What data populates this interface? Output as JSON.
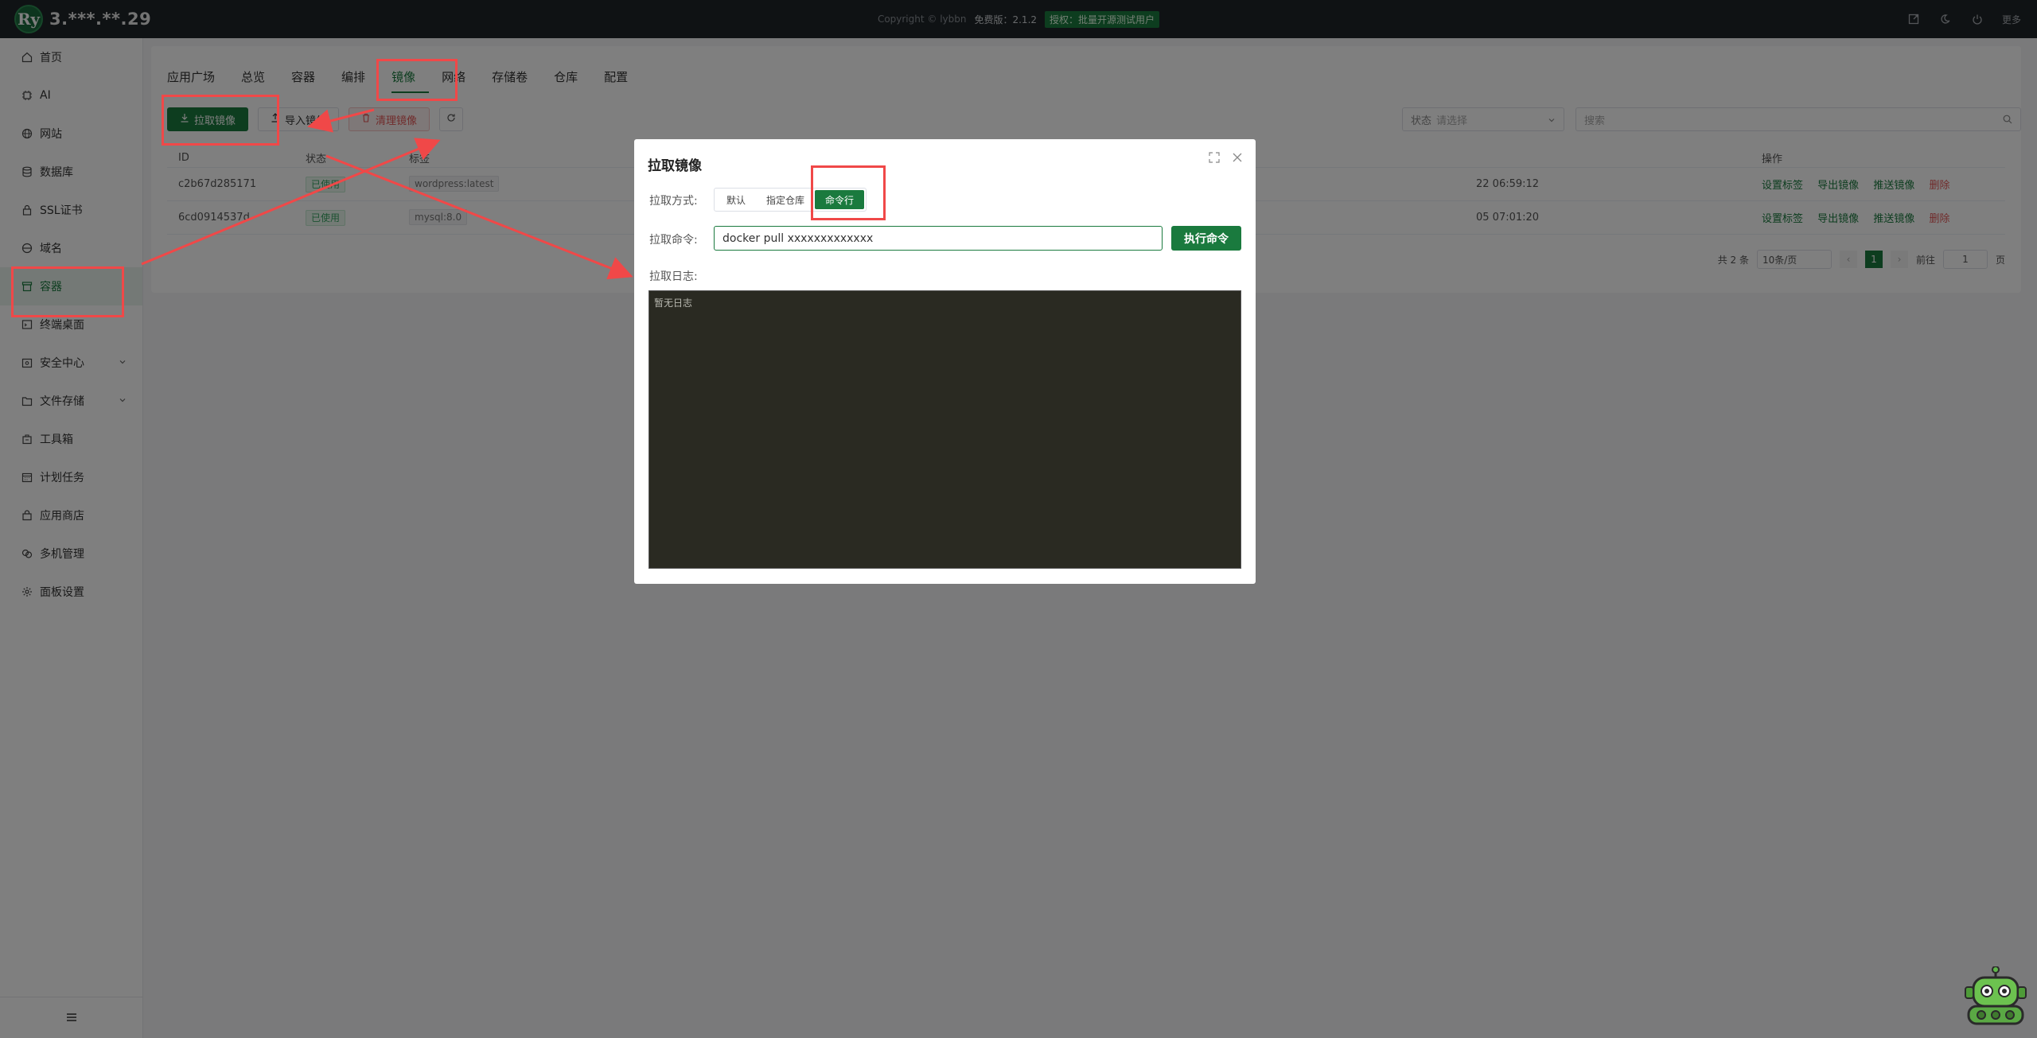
{
  "topbar": {
    "logo_text": "Ry",
    "host": "3.***.**.29",
    "copyright": "Copyright © lybbn",
    "edition": "免费版：2.1.2",
    "license": "授权：批量开源测试用户",
    "more": "更多"
  },
  "sidebar": {
    "items": [
      {
        "label": "首页",
        "icon": "home-icon"
      },
      {
        "label": "AI",
        "icon": "chip-icon"
      },
      {
        "label": "网站",
        "icon": "globe-icon"
      },
      {
        "label": "数据库",
        "icon": "database-icon"
      },
      {
        "label": "SSL证书",
        "icon": "lock-icon"
      },
      {
        "label": "域名",
        "icon": "domain-icon"
      },
      {
        "label": "容器",
        "icon": "container-icon"
      },
      {
        "label": "终端桌面",
        "icon": "terminal-icon"
      },
      {
        "label": "安全中心",
        "icon": "shield-icon"
      },
      {
        "label": "文件存储",
        "icon": "folder-icon"
      },
      {
        "label": "工具箱",
        "icon": "toolbox-icon"
      },
      {
        "label": "计划任务",
        "icon": "calendar-icon"
      },
      {
        "label": "应用商店",
        "icon": "store-icon"
      },
      {
        "label": "多机管理",
        "icon": "cluster-icon"
      },
      {
        "label": "面板设置",
        "icon": "gear-icon"
      }
    ]
  },
  "tabs": [
    "应用广场",
    "总览",
    "容器",
    "编排",
    "镜像",
    "网络",
    "存储卷",
    "仓库",
    "配置"
  ],
  "toolbar": {
    "pull": "拉取镜像",
    "import": "导入镜像",
    "clean": "清理镜像"
  },
  "filters": {
    "status_label": "状态",
    "status_placeholder": "请选择",
    "search_placeholder": "搜索"
  },
  "table": {
    "headers": [
      "ID",
      "状态",
      "标签",
      "操作"
    ],
    "rows": [
      {
        "id": "c2b67d285171",
        "status": "已使用",
        "tag": "wordpress:latest",
        "time": "22 06:59:12"
      },
      {
        "id": "6cd0914537d",
        "status": "已使用",
        "tag": "mysql:8.0",
        "time": "05 07:01:20"
      }
    ],
    "ops": {
      "set_tag": "设置标签",
      "export": "导出镜像",
      "push": "推送镜像",
      "delete": "删除"
    }
  },
  "pager": {
    "total": "共 2 条",
    "size": "10条/页",
    "current": "1",
    "goto": "前往",
    "goto_value": "1",
    "page": "页"
  },
  "dialog": {
    "title": "拉取镜像",
    "mode_label": "拉取方式:",
    "modes": [
      "默认",
      "指定仓库",
      "命令行"
    ],
    "cmd_label": "拉取命令:",
    "cmd_value": "docker pull xxxxxxxxxxxxx",
    "exec": "执行命令",
    "log_label": "拉取日志:",
    "log_empty": "暂无日志"
  },
  "colors": {
    "accent": "#1a7a3e",
    "annotation": "#f04848",
    "topbar": "#1f2428"
  }
}
